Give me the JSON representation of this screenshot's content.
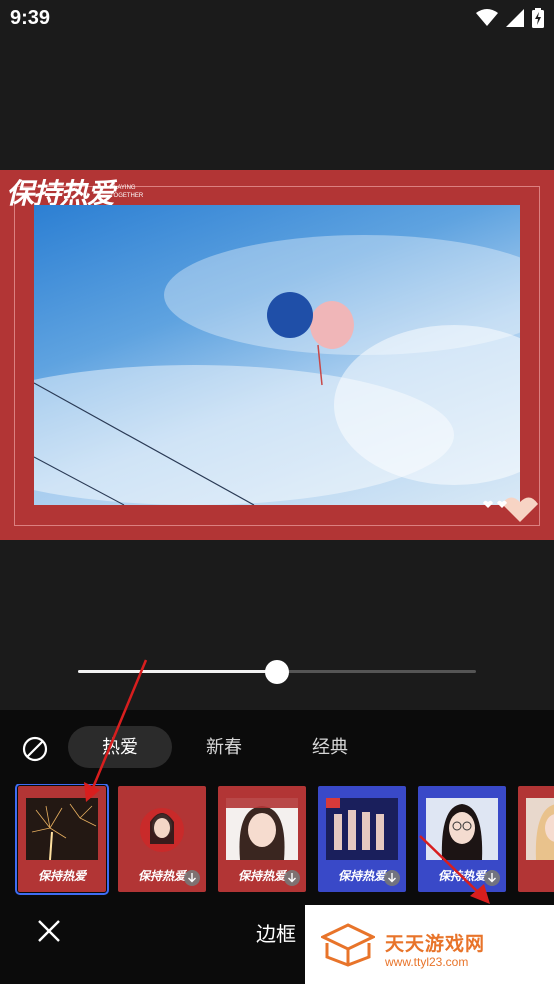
{
  "status": {
    "time": "9:39"
  },
  "frame": {
    "logo_text": "保持热爱",
    "logo_sub": "PLAYING TOGETHER"
  },
  "slider": {
    "value": 0.5
  },
  "toolbar": {
    "tabs": [
      {
        "label": "热爱",
        "active": true
      },
      {
        "label": "新春",
        "active": false
      },
      {
        "label": "经典",
        "active": false
      }
    ],
    "title": "边框"
  },
  "thumbnails": [
    {
      "caption": "保持热爱",
      "style": "red",
      "selected": true,
      "download": false
    },
    {
      "caption": "保持热爱",
      "style": "red",
      "selected": false,
      "download": true
    },
    {
      "caption": "保持热爱",
      "style": "red",
      "selected": false,
      "download": true
    },
    {
      "caption": "保持热爱",
      "style": "blue",
      "selected": false,
      "download": true
    },
    {
      "caption": "保持热爱",
      "style": "blue",
      "selected": false,
      "download": true
    },
    {
      "caption": "",
      "style": "red",
      "selected": false,
      "download": false
    }
  ],
  "watermark": {
    "name": "天天游戏网",
    "url": "www.ttyl23.com"
  },
  "colors": {
    "frame_red": "#b23535",
    "accent_blue": "#3f6df2",
    "annotation_red": "#d81e1e",
    "watermark_orange": "#e8742a"
  }
}
